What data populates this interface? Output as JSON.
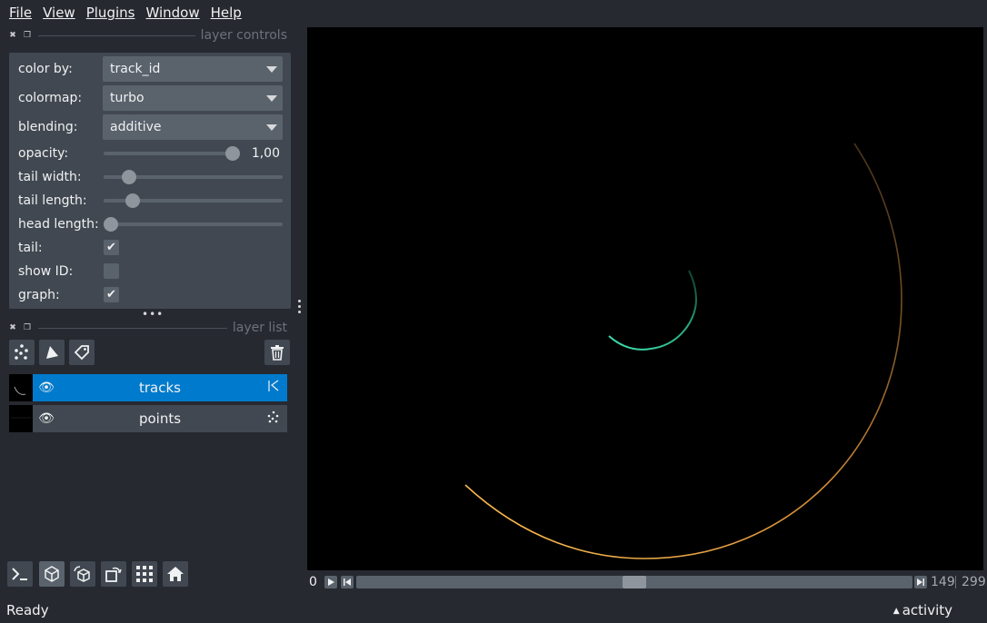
{
  "menubar": {
    "items": [
      {
        "label": "File"
      },
      {
        "label": "View"
      },
      {
        "label": "Plugins"
      },
      {
        "label": "Window"
      },
      {
        "label": "Help"
      }
    ]
  },
  "layer_controls": {
    "title": "layer controls",
    "color_by": {
      "label": "color by:",
      "value": "track_id"
    },
    "colormap": {
      "label": "colormap:",
      "value": "turbo"
    },
    "blending": {
      "label": "blending:",
      "value": "additive"
    },
    "opacity": {
      "label": "opacity:",
      "value": 1.0,
      "display": "1,00"
    },
    "tail_width": {
      "label": "tail width:",
      "value": 0.11
    },
    "tail_length": {
      "label": "tail length:",
      "value": 0.13
    },
    "head_length": {
      "label": "head length:",
      "value": 0.0
    },
    "tail": {
      "label": "tail:",
      "checked": true
    },
    "show_id": {
      "label": "show ID:",
      "checked": false
    },
    "graph": {
      "label": "graph:",
      "checked": true
    }
  },
  "layer_list": {
    "title": "layer list",
    "layers": [
      {
        "name": "tracks",
        "selected": true,
        "visible": true,
        "type_icon": "tracks-layer-icon"
      },
      {
        "name": "points",
        "selected": false,
        "visible": true,
        "type_icon": "points-layer-icon"
      }
    ]
  },
  "dims": {
    "start": "0",
    "current": "149",
    "max": "299",
    "fraction": 0.5
  },
  "status": {
    "text": "Ready",
    "activity": "activity"
  },
  "colors": {
    "accent": "#007acc",
    "background": "#262930",
    "panel": "#414851",
    "inner_track": "#3fd7a0",
    "outer_track": "#f8b040"
  }
}
